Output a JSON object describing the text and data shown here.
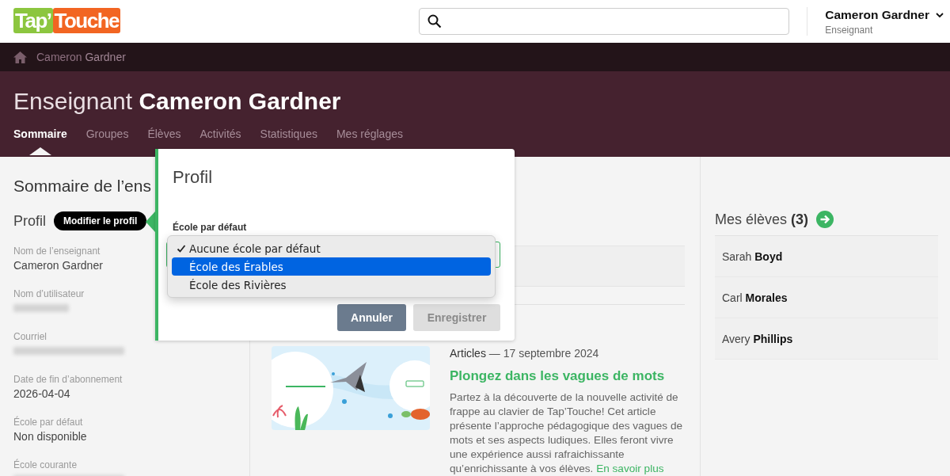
{
  "header": {
    "logo": [
      {
        "text": "Tap’",
        "color": "#8cc63f"
      },
      {
        "text": "Touche",
        "color": "#f26522"
      }
    ],
    "user": {
      "name": "Cameron Gardner",
      "role": "Enseignant"
    }
  },
  "breadcrumb": {
    "text": "Cameron **Gardner**"
  },
  "hero": {
    "title": "Enseignant **Cameron Gardner**",
    "tabs": [
      {
        "label": "Sommaire",
        "selected": true
      },
      {
        "label": "Groupes",
        "selected": false
      },
      {
        "label": "Élèves",
        "selected": false
      },
      {
        "label": "Activités",
        "selected": false
      },
      {
        "label": "Statistiques",
        "selected": false
      },
      {
        "label": "Mes réglages",
        "selected": false
      }
    ]
  },
  "left": {
    "title": "Sommaire de l’ens",
    "profile_heading": "Profil",
    "edit_button": "Modifier le profil",
    "fields": [
      {
        "label": "Nom de l’enseignant",
        "value": "Cameron Gardner",
        "redacted": false
      },
      {
        "label": "Nom d’utilisateur",
        "redacted": true
      },
      {
        "label": "Courriel",
        "redacted": true
      },
      {
        "label": "Date de fin d’abonnement",
        "value": "2026-04-04",
        "redacted": false
      },
      {
        "label": "École par défaut",
        "value": "Non disponible",
        "redacted": false
      },
      {
        "label": "École courante",
        "redacted": true
      }
    ]
  },
  "article": {
    "kind": "picture",
    "category": "Articles",
    "date": "— 17 septembre 2024",
    "title": "Plongez dans les vagues de mots",
    "body": "Partez à la découverte de la nouvelle activité de frappe au clavier de Tap’Touche! Cet article présente l’approche pédagogique des vagues de mots et ses aspects ludiques. Elles feront vivre une expérience aussi rafraichissante qu’enrichissante à vos élèves.",
    "link": "En savoir plus"
  },
  "students": {
    "heading": "Mes élèves **(3)**",
    "items": [
      {
        "name": "Sarah **Boyd**"
      },
      {
        "name": "Carl **Morales**"
      },
      {
        "name": "Avery **Phillips**"
      }
    ]
  },
  "dialog": {
    "title": "Profil",
    "field_label": "École par défaut",
    "options": [
      {
        "label": "Aucune école par défaut",
        "checked": true,
        "selected": false
      },
      {
        "label": "École des Érables",
        "checked": false,
        "selected": true
      },
      {
        "label": "École des Rivières",
        "checked": false,
        "selected": false
      }
    ],
    "buttons": [
      {
        "label": "Annuler",
        "disabled": false
      },
      {
        "label": "Enregistrer",
        "disabled": true
      }
    ]
  }
}
